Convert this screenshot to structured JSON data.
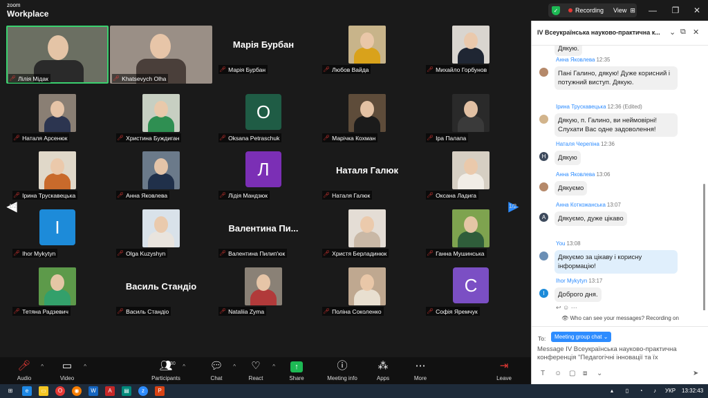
{
  "titlebar": {
    "logo_top": "zoom",
    "logo_bottom": "Workplace",
    "recording_label": "Recording",
    "view_label": "View"
  },
  "gallery": {
    "page_indicator_left": "1/2",
    "page_indicator_right": "1/2",
    "tiles": [
      {
        "name": "Лілія Мідак",
        "kind": "video",
        "bg": "#6b6f62",
        "shirt": "#2a2a2a"
      },
      {
        "name": "Khatsevych Olha",
        "kind": "video",
        "bg": "#9a8f86",
        "shirt": "#4a3f3a"
      },
      {
        "name": "Марія Бурбан",
        "kind": "text",
        "display": "Марія Бурбан"
      },
      {
        "name": "Любов Вайда",
        "kind": "video",
        "bg": "#c8b48a",
        "shirt": "#d9a21b"
      },
      {
        "name": "Михайло Горбунов",
        "kind": "video",
        "bg": "#d9d5cf",
        "shirt": "#1f2633"
      },
      {
        "name": "Наталя Арсенюк",
        "kind": "video",
        "bg": "#8a7f74",
        "shirt": "#2c3550"
      },
      {
        "name": "Христина Буждиган",
        "kind": "video",
        "bg": "#c7cfc2",
        "shirt": "#2f8f52"
      },
      {
        "name": "Oksana Petraschuk",
        "kind": "avatar",
        "letter": "O",
        "color": "#1f5c45"
      },
      {
        "name": "Марічка Кохман",
        "kind": "video",
        "bg": "#5e4c3a",
        "shirt": "#1b1b1b"
      },
      {
        "name": "Іра Палапа",
        "kind": "video",
        "bg": "#2a2a2a",
        "shirt": "#3a3a3a"
      },
      {
        "name": "Ірина Трускавецька",
        "kind": "video",
        "bg": "#e0d8c9",
        "shirt": "#c96a2b"
      },
      {
        "name": "Анна Яковлева",
        "kind": "video",
        "bg": "#6b7a8a",
        "shirt": "#20304a"
      },
      {
        "name": "Лідія Мандзюк",
        "kind": "avatar",
        "letter": "Л",
        "color": "#7b2fb5"
      },
      {
        "name": "Наталя Галюк",
        "kind": "text",
        "display": "Наталя Галюк"
      },
      {
        "name": "Оксана Ладига",
        "kind": "video",
        "bg": "#d6cfc3",
        "shirt": "#f1ede6"
      },
      {
        "name": "Ihor Mykytyn",
        "kind": "avatar",
        "letter": "I",
        "color": "#1d8bd9"
      },
      {
        "name": "Olga Kuzyshyn",
        "kind": "video",
        "bg": "#d9e2ea",
        "shirt": "#e9e4de"
      },
      {
        "name": "Валентина Пилип'юк",
        "kind": "text",
        "display": "Валентина  Пи..."
      },
      {
        "name": "Христя Берладинюк",
        "kind": "video",
        "bg": "#e4ddd5",
        "shirt": "#c9b8a6"
      },
      {
        "name": "Ганна Мушинська",
        "kind": "video",
        "bg": "#7ea34f",
        "shirt": "#2f5d3a"
      },
      {
        "name": "Тетяна Радзевич",
        "kind": "video",
        "bg": "#5d9a4a",
        "shirt": "#33a06b"
      },
      {
        "name": "Василь Стандіо",
        "kind": "text",
        "display": "Василь Стандіо"
      },
      {
        "name": "Nataliia Zyma",
        "kind": "video",
        "bg": "#8a8176",
        "shirt": "#b13a3a"
      },
      {
        "name": "Поліна Соколенко",
        "kind": "video",
        "bg": "#bfa890",
        "shirt": "#e8dfd0"
      },
      {
        "name": "Софія Яремчук",
        "kind": "avatar",
        "letter": "C",
        "color": "#7b4fc4"
      }
    ]
  },
  "toolbar": {
    "audio": "Audio",
    "video": "Video",
    "participants": "Participants",
    "participants_count": "30",
    "chat": "Chat",
    "react": "React",
    "share": "Share",
    "meeting_info": "Meeting info",
    "apps": "Apps",
    "more": "More",
    "leave": "Leave"
  },
  "chat": {
    "title": "IV Всеукраїнська науково-практична к...",
    "top_partial": "Дякую.",
    "messages": [
      {
        "sender": "Анна Яковлева",
        "time": "12:35",
        "text": "Пані Галино, дякую!  Дуже корисний і потужний виступ. Дякую.",
        "avatar": "photo",
        "color": "#b5896a"
      },
      {
        "sender": "Ірина Трускавецька",
        "time": "12:36 (Edited)",
        "text": "Дякую, п. Галино, ви неймовірні! Слухати Вас одне задоволення!",
        "avatar": "photo",
        "color": "#d2b48c"
      },
      {
        "sender": "Наталя Черепіна",
        "time": "12:36",
        "text": "Дякую",
        "avatar": "H",
        "color": "#3d4a5c"
      },
      {
        "sender": "Анна Яковлева",
        "time": "13:06",
        "text": "Дякуємо",
        "avatar": "photo",
        "color": "#b5896a"
      },
      {
        "sender": "Анна Коткожанська",
        "time": "13:07",
        "text": "Дякуємо, дуже цікаво",
        "avatar": "A",
        "color": "#3d4a5c"
      },
      {
        "sender": "You",
        "time": "13:08",
        "text": "Дякуємо за цікаву і корисну інформацію!",
        "avatar": "photo",
        "color": "#6b8fb5",
        "mine": true
      },
      {
        "sender": "Ihor Mykytyn",
        "time": "13:17",
        "text": "Доброго дня.",
        "avatar": "I",
        "color": "#1d8bd9"
      }
    ],
    "privacy_note": "Who can see your messages? Recording on",
    "to_label": "To:",
    "to_value": "Meeting group chat",
    "input_value": "Message IV Всеукраїнська науково-практична конференція \"Педагогічні інновації та їх"
  },
  "taskbar": {
    "lang": "УКР",
    "time": "13:32:43"
  }
}
